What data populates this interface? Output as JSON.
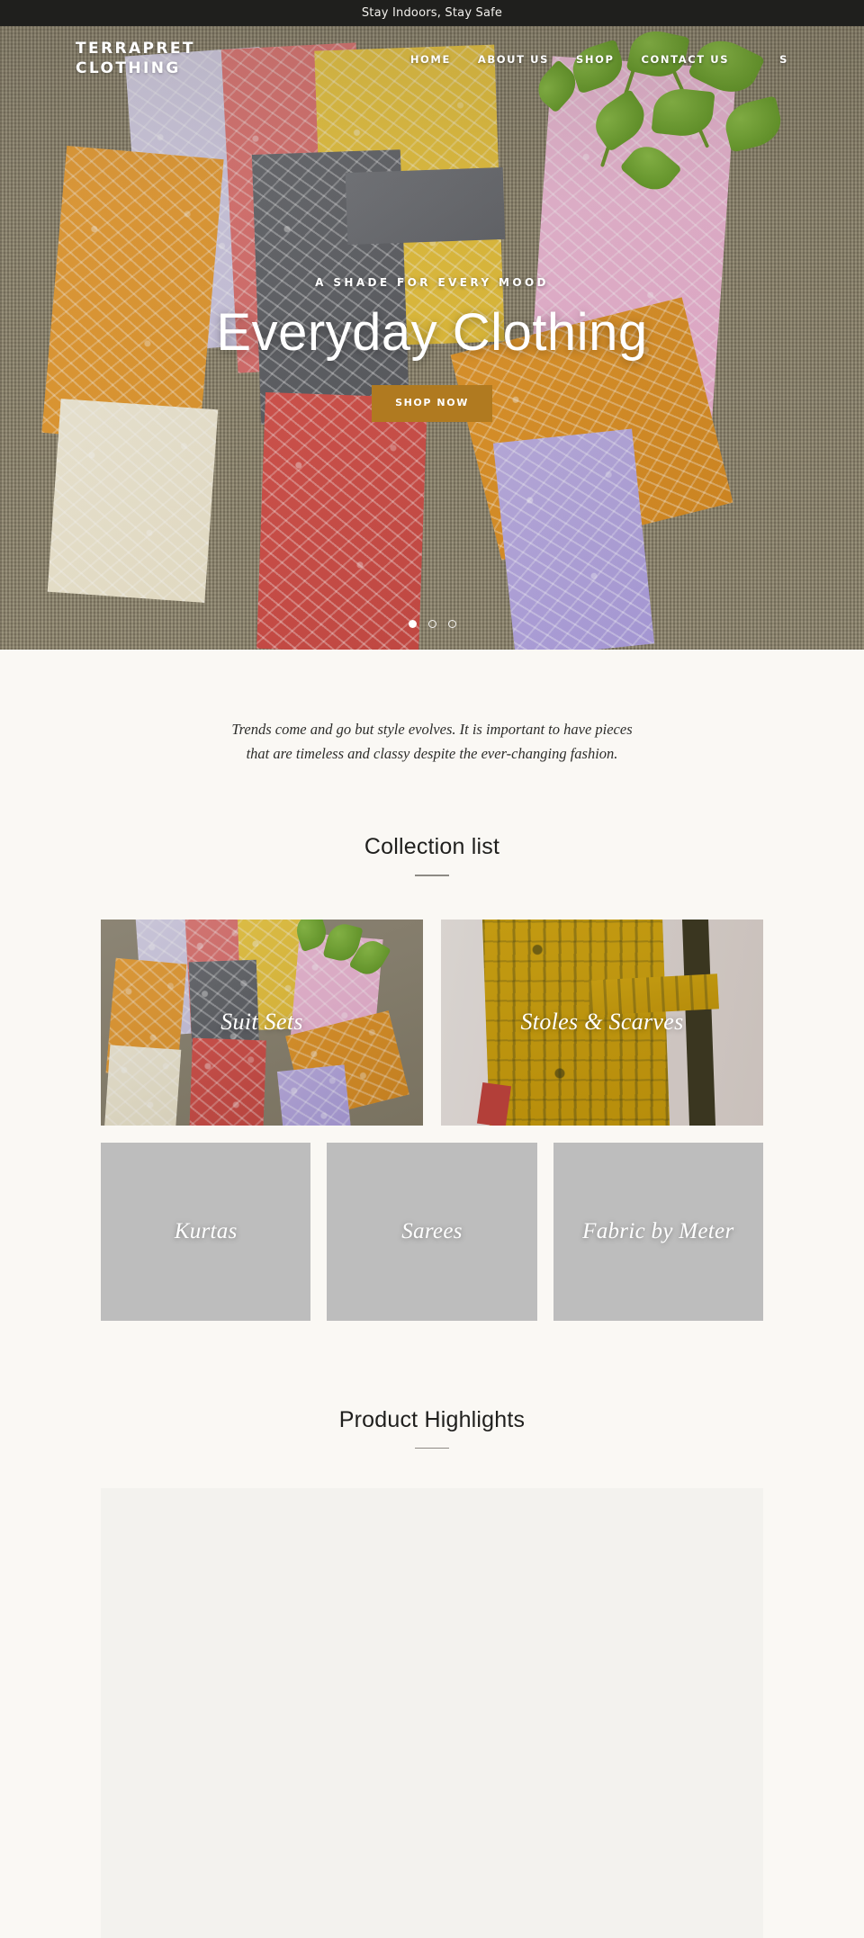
{
  "announcement": {
    "text": "Stay Indoors, Stay Safe"
  },
  "header": {
    "logo": "TERRAPRET CLOTHING",
    "nav": [
      {
        "label": "HOME",
        "name": "nav-link-home"
      },
      {
        "label": "ABOUT US",
        "name": "nav-link-about-us"
      },
      {
        "label": "SHOP",
        "name": "nav-link-shop"
      },
      {
        "label": "CONTACT US",
        "name": "nav-link-contact-us"
      }
    ],
    "utility_label": "S"
  },
  "hero": {
    "eyebrow": "A SHADE FOR EVERY MOOD",
    "title": "Everyday Clothing",
    "cta_label": "SHOP NOW",
    "carousel": {
      "slide_count": 3,
      "active_index": 0
    }
  },
  "intro": {
    "line1": "Trends come and go but style evolves. It is important to have pieces",
    "line2": "that are timeless and classy despite the ever-changing fashion."
  },
  "collections": {
    "heading": "Collection list",
    "row_featured": [
      {
        "label": "Suit Sets",
        "name": "collection-card-suit-sets"
      },
      {
        "label": "Stoles & Scarves",
        "name": "collection-card-stoles-scarves"
      }
    ],
    "row_secondary": [
      {
        "label": "Kurtas",
        "name": "collection-card-kurtas"
      },
      {
        "label": "Sarees",
        "name": "collection-card-sarees"
      },
      {
        "label": "Fabric by Meter",
        "name": "collection-card-fabric-by-meter"
      }
    ]
  },
  "highlights": {
    "heading": "Product Highlights"
  },
  "colors": {
    "announcement_bg": "#1f1f1d",
    "page_bg": "#faf8f4",
    "cta_bg": "#b07a20",
    "placeholder_bg": "#bdbdbd",
    "panel_bg": "#f3f2ee",
    "heading_text": "#1f1f1d"
  }
}
